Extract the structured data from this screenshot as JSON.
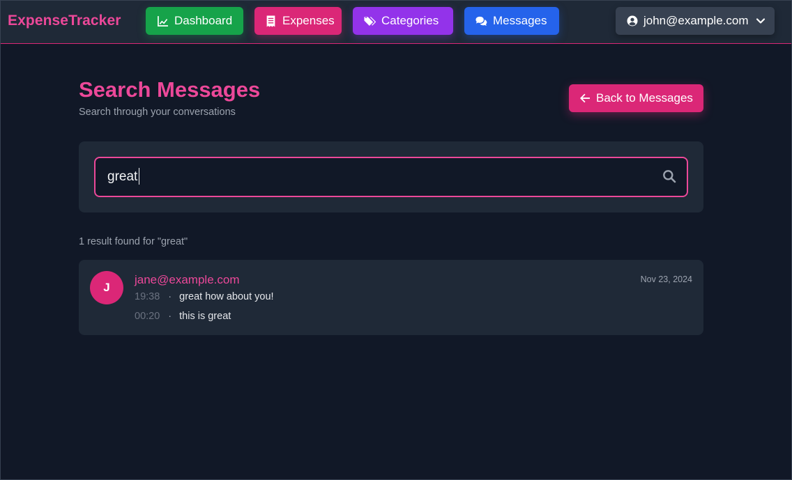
{
  "nav": {
    "brand": "ExpenseTracker",
    "items": [
      {
        "label": "Dashboard",
        "icon": "chart-line-icon",
        "color": "#16a34a"
      },
      {
        "label": "Expenses",
        "icon": "receipt-icon",
        "color": "#db2777"
      },
      {
        "label": "Categories",
        "icon": "tags-icon",
        "color": "#9333ea"
      },
      {
        "label": "Messages",
        "icon": "comments-icon",
        "color": "#2563eb"
      }
    ],
    "user": {
      "email": "john@example.com",
      "icon": "user-circle-icon"
    }
  },
  "header": {
    "title": "Search Messages",
    "subtitle": "Search through your conversations",
    "back_label": "Back to Messages"
  },
  "search": {
    "value": "great",
    "icon": "search-icon"
  },
  "results": {
    "count_text": "1 result found for \"great\"",
    "items": [
      {
        "avatar_initial": "J",
        "sender": "jane@example.com",
        "date": "Nov 23, 2024",
        "messages": [
          {
            "time": "19:38",
            "text": "great how about you!"
          },
          {
            "time": "00:20",
            "text": "this is great"
          }
        ]
      }
    ]
  },
  "colors": {
    "background": "#111827",
    "panel": "#1f2937",
    "accent": "#ec4899"
  }
}
